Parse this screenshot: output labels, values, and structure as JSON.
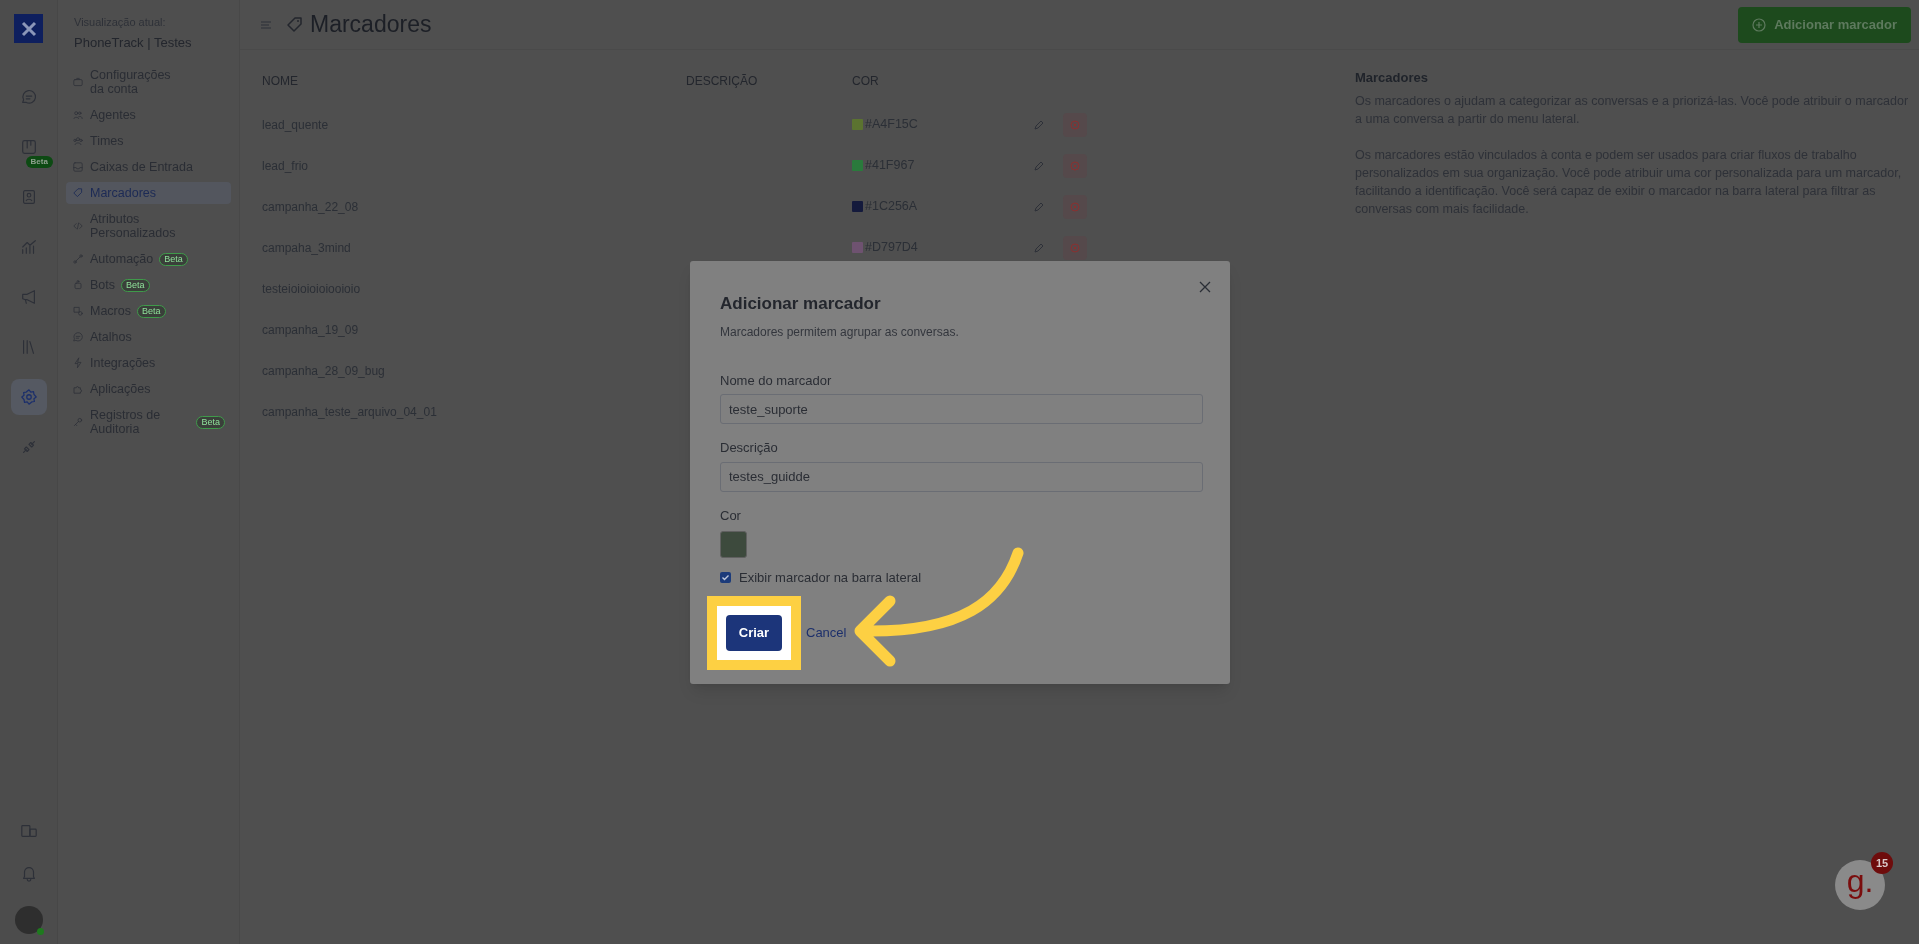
{
  "workspace": {
    "caption": "Visualização atual:",
    "name": "PhoneTrack | Testes"
  },
  "rail": [
    {
      "kind": "chat",
      "selected": false
    },
    {
      "kind": "kanban",
      "selected": false,
      "badge": "Beta"
    },
    {
      "kind": "contacts",
      "selected": false
    },
    {
      "kind": "reports",
      "selected": false
    },
    {
      "kind": "campaigns",
      "selected": false
    },
    {
      "kind": "library",
      "selected": false
    },
    {
      "kind": "settings",
      "selected": true
    },
    {
      "kind": "integrations",
      "selected": false
    }
  ],
  "rail_bottom": [
    {
      "kind": "layout"
    },
    {
      "kind": "bell"
    },
    {
      "kind": "avatar",
      "online": true
    }
  ],
  "sidebar": {
    "items": [
      {
        "label": "Configurações da conta",
        "kind": "briefcase",
        "selected": false
      },
      {
        "label": "Agentes",
        "kind": "people",
        "selected": false
      },
      {
        "label": "Times",
        "kind": "team",
        "selected": false
      },
      {
        "label": "Caixas de Entrada",
        "kind": "inbox",
        "selected": false
      },
      {
        "label": "Marcadores",
        "kind": "tag",
        "selected": true
      },
      {
        "label": "Atributos Personalizados",
        "kind": "code",
        "selected": false
      },
      {
        "label": "Automação",
        "kind": "flow",
        "selected": false,
        "badge": "Beta"
      },
      {
        "label": "Bots",
        "kind": "bot",
        "selected": false,
        "badge": "Beta"
      },
      {
        "label": "Macros",
        "kind": "macro",
        "selected": false,
        "badge": "Beta"
      },
      {
        "label": "Atalhos",
        "kind": "chat",
        "selected": false
      },
      {
        "label": "Integrações",
        "kind": "bolt",
        "selected": false
      },
      {
        "label": "Aplicações",
        "kind": "puzzle",
        "selected": false
      },
      {
        "label": "Registros de Auditoria",
        "kind": "key",
        "selected": false,
        "badge": "Beta"
      }
    ]
  },
  "header": {
    "title": "Marcadores",
    "button": "Adicionar marcador"
  },
  "table": {
    "columns": [
      "NOME",
      "DESCRIÇÃO",
      "COR"
    ],
    "rows": [
      {
        "name": "lead_quente",
        "color_text": "#A4F15C",
        "color": "#5b7330"
      },
      {
        "name": "lead_frio",
        "color_text": "#41F967",
        "color": "#2a7a3c"
      },
      {
        "name": "campanha_22_08",
        "color_text": "#1C256A",
        "color": "#141a3c"
      },
      {
        "name": "campaha_3mind",
        "color_text": "#D797D4",
        "color": "#6e5270"
      },
      {
        "name": "testeioioioioiooioio"
      },
      {
        "name": "campanha_19_09"
      },
      {
        "name": "campanha_28_09_bug"
      },
      {
        "name": "campanha_teste_arquivo_04_01"
      }
    ]
  },
  "help_panel": {
    "title": "Marcadores",
    "paragraphs": [
      "Os marcadores o ajudam a categorizar as conversas e a priorizá-las. Você pode atribuir o marcador a uma conversa a partir do menu lateral.",
      "Os marcadores estão vinculados à conta e podem ser usados para criar fluxos de trabalho personalizados em sua organização. Você pode atribuir uma cor personalizada para um marcador, facilitando a identificação. Você será capaz de exibir o marcador na barra lateral para filtrar as conversas com mais facilidade."
    ]
  },
  "modal": {
    "title": "Adicionar marcador",
    "subtitle": "Marcadores permitem agrupar as conversas.",
    "fields": [
      {
        "label": "Nome do marcador",
        "value": "teste_suporte"
      },
      {
        "label": "Descrição",
        "value": "testes_guidde"
      }
    ],
    "color_label": "Cor",
    "color": "#3d4a3d",
    "checkbox": {
      "label": "Exibir marcador na barra lateral",
      "checked": true
    },
    "primary": "Criar",
    "secondary": "Cancel"
  },
  "help_widget": {
    "label": "g.",
    "badge": "15"
  }
}
